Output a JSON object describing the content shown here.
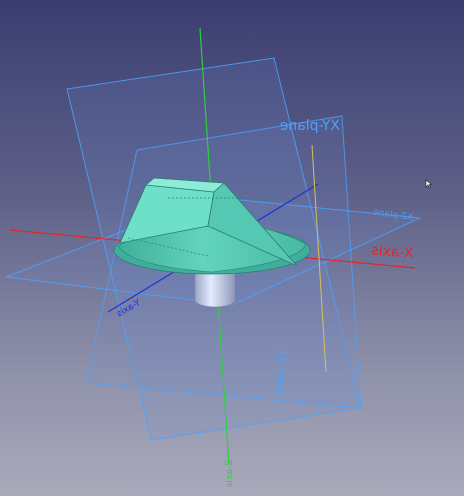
{
  "scene": {
    "labels": {
      "xy_plane": "XY-plane",
      "xz_plane": "XZ-plane",
      "yz_plane": "YZ-plane",
      "x_axis": "X-axis",
      "y_axis": "Y-axis",
      "z_axis": "Z-axis"
    },
    "colors": {
      "background_top": "#3b3d70",
      "background_bottom": "#a9aabb",
      "x_axis": "#e0262b",
      "y_axis": "#2230d8",
      "z_axis": "#2ad23a",
      "plane_edge": "#4aa3ff",
      "solid_face": "#64d8c0",
      "solid_dark": "#3aa995",
      "shaft": "#c8d4ee",
      "guide_line": "#d8c060"
    },
    "icons": {
      "cursor": "mouse-pointer-icon"
    }
  }
}
